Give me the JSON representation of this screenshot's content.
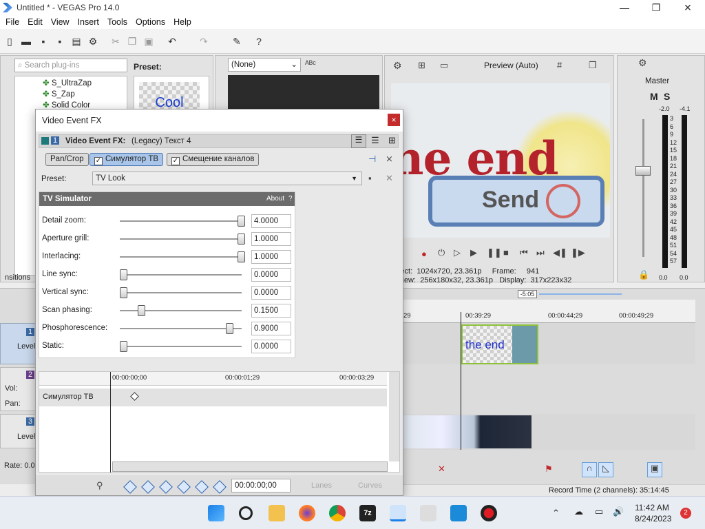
{
  "window": {
    "title": "Untitled * - VEGAS Pro 14.0",
    "minimize": "—",
    "restore": "❐",
    "close": "✕"
  },
  "menu": [
    "File",
    "Edit",
    "View",
    "Insert",
    "Tools",
    "Options",
    "Help"
  ],
  "plugins": {
    "search_placeholder": "Search plug-ins",
    "items": [
      "S_UltraZap",
      "S_Zap",
      "Solid Color"
    ],
    "preset_label": "Preset:",
    "preview_text": "Cool",
    "transitions_tab": "nsitions"
  },
  "trimmer": {
    "dropdown": "(None)"
  },
  "preview": {
    "mode": "Preview (Auto)",
    "frame_text": "the end",
    "button_text": "Send",
    "info_project_label": "ject:",
    "info_project": "1024x720, 23.361p",
    "info_preview_label": "view:",
    "info_preview": "256x180x32, 23.361p",
    "frame_label": "Frame:",
    "frame_value": "941",
    "display_label": "Display:",
    "display_value": "317x223x32"
  },
  "master": {
    "label": "Master",
    "m": "M",
    "s": "S",
    "peak_l": "-2.0",
    "peak_r": "-4.1",
    "ticks": [
      "3",
      "6",
      "9",
      "12",
      "15",
      "18",
      "21",
      "24",
      "27",
      "30",
      "33",
      "36",
      "39",
      "42",
      "45",
      "48",
      "51",
      "54",
      "57"
    ],
    "bottom_l": "0.0",
    "bottom_r": "0.0"
  },
  "dialog": {
    "title": "Video Event FX",
    "close": "×",
    "header_num": "1",
    "header_label": "Video Event FX:",
    "header_value": "(Legacy) Текст 4",
    "tabs": [
      "Pan/Crop",
      "Симулятор ТВ",
      "Смещение каналов"
    ],
    "preset_label": "Preset:",
    "preset_value": "TV Look",
    "panel_title": "TV Simulator",
    "about": "About",
    "help": "?",
    "params": [
      {
        "label": "Detail zoom:",
        "value": "4.0000",
        "level": 1.0
      },
      {
        "label": "Aperture grill:",
        "value": "1.0000",
        "level": 1.0
      },
      {
        "label": "Interlacing:",
        "value": "1.0000",
        "level": 1.0
      },
      {
        "label": "Line sync:",
        "value": "0.0000",
        "level": 0.0
      },
      {
        "label": "Vertical sync:",
        "value": "0.0000",
        "level": 0.0
      },
      {
        "label": "Scan phasing:",
        "value": "0.1500",
        "level": 0.15
      },
      {
        "label": "Phosphorescence:",
        "value": "0.9000",
        "level": 0.9
      },
      {
        "label": "Static:",
        "value": "0.0000",
        "level": 0.0
      }
    ],
    "keyframe_times": [
      "00:00:00;00",
      "00:00:01;29",
      "00:00:03;29"
    ],
    "keyframe_track": "Симулятор ТВ",
    "bottom_time": "00:00:00;00",
    "lanes": "Lanes",
    "curves": "Curves"
  },
  "timeline": {
    "offset": "-5:05",
    "ticks": [
      "29",
      "00:39:29",
      "00:00:44;29",
      "00:00:49;29"
    ],
    "clip_text": "the end",
    "track1_num": "1",
    "track2_num": "2",
    "track3_num": "3",
    "level": "Level",
    "vol": "Vol:",
    "pan": "Pan:",
    "rate": "Rate: 0.0",
    "record_time": "Record Time (2 channels): 35:14:45"
  },
  "taskbar": {
    "time": "11:42 AM",
    "date": "8/24/2023",
    "badge": "2"
  }
}
